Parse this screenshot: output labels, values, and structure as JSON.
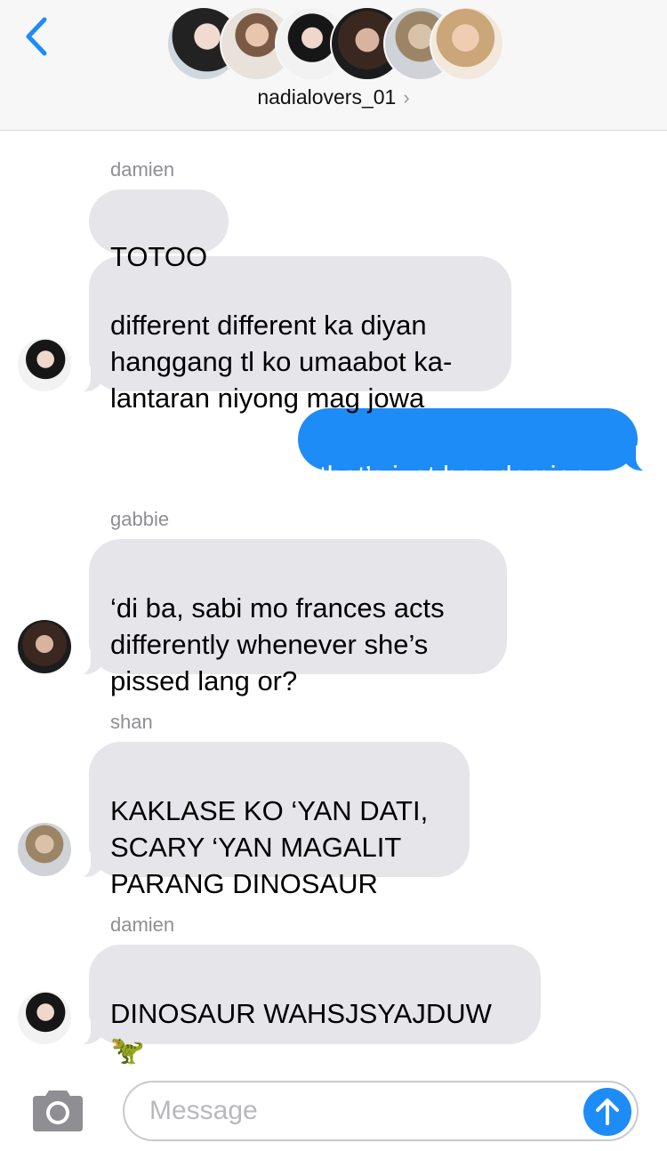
{
  "header": {
    "group_name": "nadialovers_01",
    "chevron": "›",
    "back_icon": "chevron-left-icon",
    "member_avatars": [
      "member-avatar-1",
      "member-avatar-2",
      "member-avatar-3",
      "member-avatar-4",
      "member-avatar-5",
      "member-avatar-6"
    ]
  },
  "messages": [
    {
      "sender": "damien"
    },
    {
      "text": "TOTOO"
    },
    {
      "text": "different different ka diyan\nhanggang tl ko umaabot ka-\nlantaran niyong mag jowa"
    },
    {
      "text": "that’s just her, damien"
    },
    {
      "sender": "gabbie",
      "text": "‘di ba, sabi mo frances acts\ndifferently whenever she’s\npissed lang or?"
    },
    {
      "sender": "shan",
      "text": "KAKLASE KO ‘YAN DATI,\nSCARY ‘YAN MAGALIT\nPARANG DINOSAUR"
    },
    {
      "sender": "damien",
      "text": "DINOSAUR WAHSJSYAJDUW\n🦖"
    }
  ],
  "composer": {
    "placeholder": "Message",
    "camera_icon": "camera-icon",
    "send_icon": "arrow-up-icon"
  },
  "colors": {
    "accent": "#1e8cf6",
    "incoming_bubble": "#e5e5ea",
    "header_bg": "#f7f7f7"
  }
}
